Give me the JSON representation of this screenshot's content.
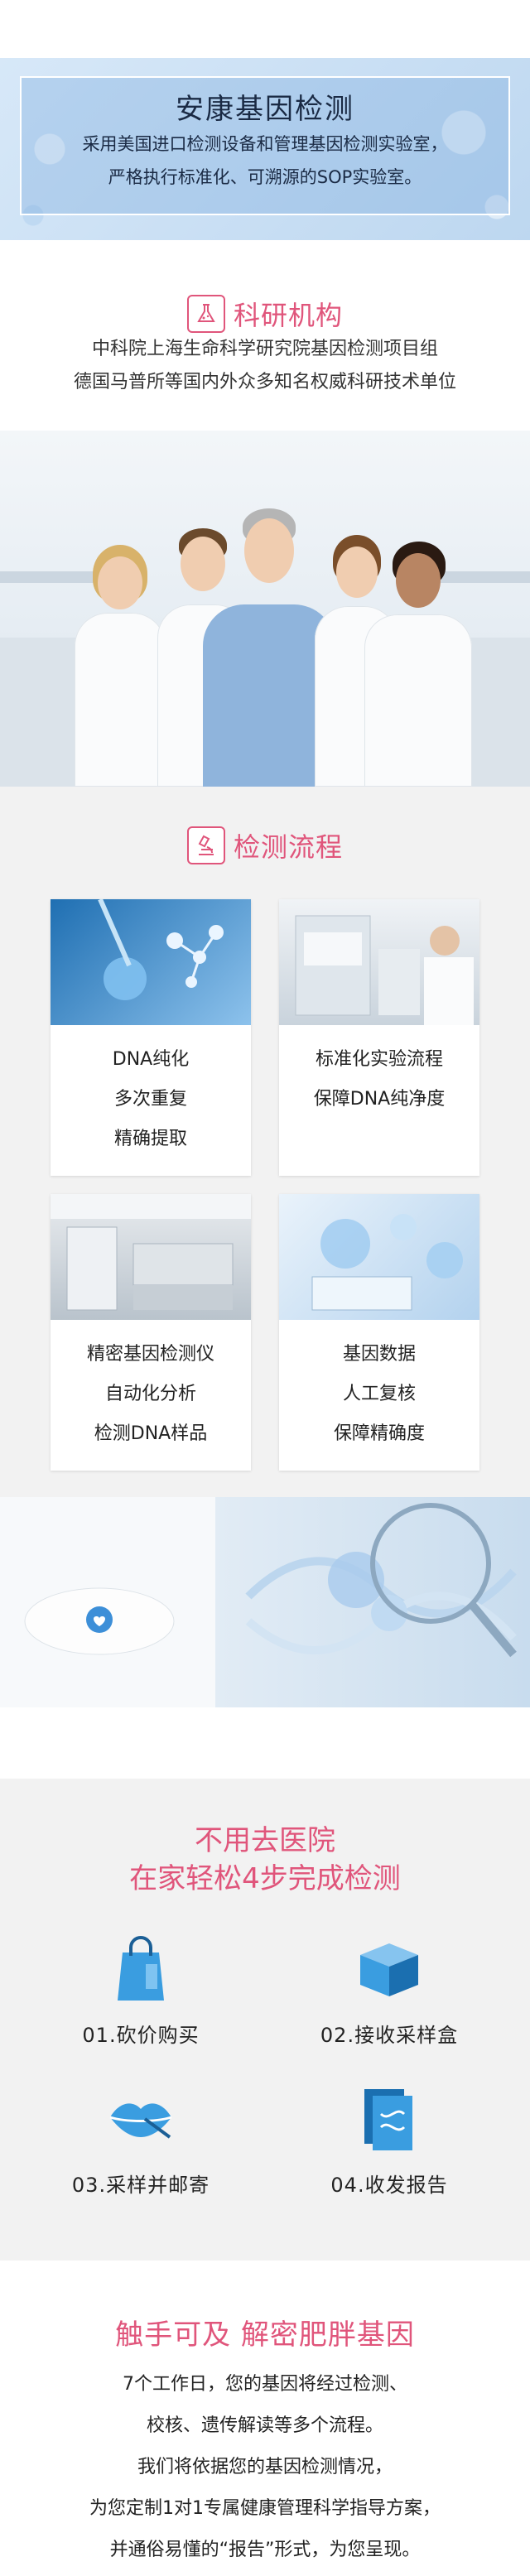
{
  "hero": {
    "title": "安康基因检测",
    "line1": "采用美国进口检测设备和管理基因检测实验室，",
    "line2": "严格执行标准化、可溯源的SOP实验室。"
  },
  "research": {
    "heading": "科研机构",
    "line1": "中科院上海生命科学研究院基因检测项目组",
    "line2": "德国马普所等国内外众多知名权威科研技术单位"
  },
  "process": {
    "heading": "检测流程",
    "cards": [
      {
        "lines": [
          "DNA纯化",
          "多次重复",
          "精确提取"
        ]
      },
      {
        "lines": [
          "标准化实验流程",
          "保障DNA纯净度"
        ]
      },
      {
        "lines": [
          "精密基因检测仪",
          "自动化分析",
          "检测DNA样品"
        ]
      },
      {
        "lines": [
          "基因数据",
          "人工复核",
          "保障精确度"
        ]
      }
    ]
  },
  "steps": {
    "title1": "不用去医院",
    "title2": "在家轻松4步完成检测",
    "items": [
      {
        "label": "01.砍价购买",
        "icon": "shopping-bag-icon"
      },
      {
        "label": "02.接收采样盒",
        "icon": "box-icon"
      },
      {
        "label": "03.采样并邮寄",
        "icon": "lips-swab-icon"
      },
      {
        "label": "04.收发报告",
        "icon": "report-icon"
      }
    ]
  },
  "footer": {
    "title": "触手可及  解密肥胖基因",
    "lines": [
      "7个工作日，您的基因将经过检测、",
      "校核、遗传解读等多个流程。",
      "我们将依据您的基因检测情况，",
      "为您定制1对1专属健康管理科学指导方案，",
      "并通俗易懂的“报告”形式，为您呈现。"
    ]
  },
  "colors": {
    "accent": "#e0557b",
    "hero_text": "#1a2a44",
    "panel_bg": "#f2f2f2"
  }
}
